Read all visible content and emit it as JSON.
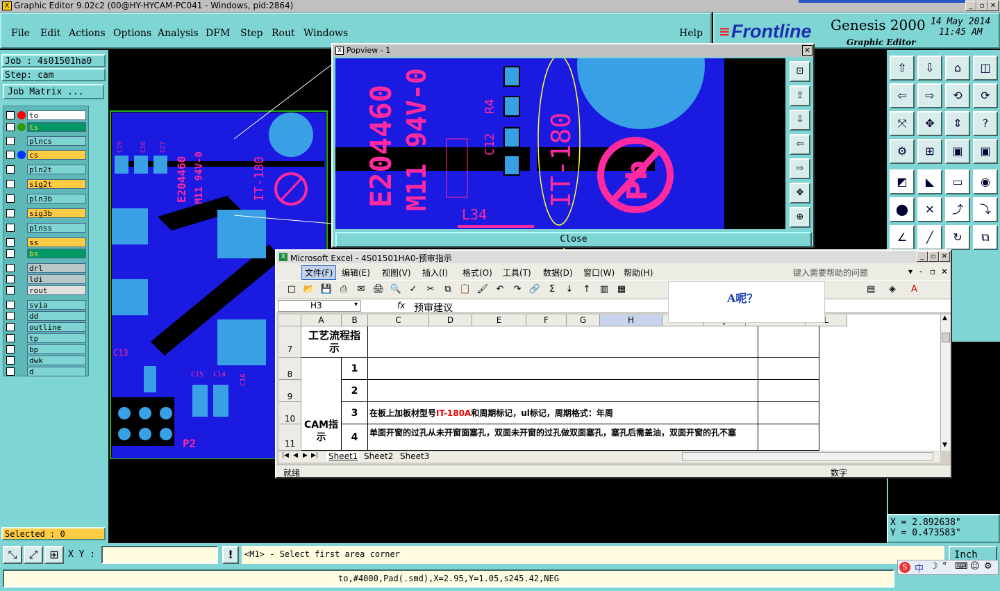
{
  "window": {
    "title": "Graphic Editor 9.02c2 (00@HY-HYCAM-PC041 - Windows, pid:2864)"
  },
  "menu": [
    "File",
    "Edit",
    "Actions",
    "Options",
    "Analysis",
    "DFM",
    "Step",
    "Rout",
    "Windows"
  ],
  "help": "Help",
  "brand": {
    "logo": "Frontline",
    "product": "Genesis 2000",
    "sub": "Graphic Editor",
    "date": "14 May 2014",
    "time": "11:45 AM"
  },
  "job": {
    "job": "Job : 4s01501ha0",
    "step": "Step: cam",
    "matrix": "Job Matrix ..."
  },
  "layers": [
    {
      "name": "to",
      "bg": "#ffffff",
      "dot": "#ff0000"
    },
    {
      "name": "ts",
      "bg": "#009966",
      "dot": "#339900"
    },
    {
      "name": "plncs",
      "bg": "#7fd4d4",
      "dot": ""
    },
    {
      "name": "cs",
      "bg": "#ffcc44",
      "dot": "#0033ff"
    },
    {
      "name": "pln2t",
      "bg": "#7fd4d4",
      "dot": ""
    },
    {
      "name": "sig2t",
      "bg": "#ffcc44",
      "dot": ""
    },
    {
      "name": "pln3b",
      "bg": "#7fd4d4",
      "dot": ""
    },
    {
      "name": "sig3b",
      "bg": "#ffcc44",
      "dot": ""
    },
    {
      "name": "plnss",
      "bg": "#7fd4d4",
      "dot": ""
    },
    {
      "name": "ss",
      "bg": "#ffcc44",
      "dot": ""
    },
    {
      "name": "bs",
      "bg": "#009966",
      "dot": ""
    },
    {
      "name": "drl",
      "bg": "#b8c8c8",
      "dot": ""
    },
    {
      "name": "ldi",
      "bg": "#b8c8c8",
      "dot": ""
    },
    {
      "name": "rout",
      "bg": "#e0e0e0",
      "dot": ""
    },
    {
      "name": "svia",
      "bg": "#7fd4d4",
      "dot": ""
    },
    {
      "name": "dd",
      "bg": "#7fd4d4",
      "dot": ""
    },
    {
      "name": "outline",
      "bg": "#7fd4d4",
      "dot": ""
    },
    {
      "name": "tp",
      "bg": "#7fd4d4",
      "dot": ""
    },
    {
      "name": "bp",
      "bg": "#7fd4d4",
      "dot": ""
    },
    {
      "name": "dwk",
      "bg": "#7fd4d4",
      "dot": ""
    },
    {
      "name": "d",
      "bg": "#7fd4d4",
      "dot": ""
    }
  ],
  "selected": "Selected : 0",
  "coords": {
    "x": "X = 2.892638\"",
    "y": "Y = 0.473583\""
  },
  "xy_label": "X Y :",
  "prompt": "<M1> - Select first area corner",
  "units": "Inch",
  "status_line": "to,#4000,Pad(.smd),X=2.95,Y=1.05,s245.42,NEG",
  "popview": {
    "title": "Popview - 1",
    "close": "Close"
  },
  "board_text": {
    "ul": "E204460",
    "mat": "M11 94V-0",
    "part": "IT-180",
    "ref_l34": "L34",
    "ref_r4": "R4",
    "ref_c12": "C12",
    "pb": "Pb",
    "p2": "P2",
    "c15": "C15",
    "c14": "C14",
    "c16": "C16",
    "c13": "C13",
    "c19": "C19",
    "c26": "C26",
    "c27": "C27"
  },
  "excel": {
    "title": "Microsoft Excel - 4S01501HA0-预审指示",
    "menu": [
      "文件(F)",
      "编辑(E)",
      "视图(V)",
      "插入(I)",
      "格式(O)",
      "工具(T)",
      "数据(D)",
      "窗口(W)",
      "帮助(H)"
    ],
    "help_box": "键入需要帮助的问题",
    "namebox": "H3",
    "formula": "预审建议",
    "columns": [
      "A",
      "B",
      "C",
      "D",
      "E",
      "F",
      "G",
      "H",
      "I",
      "J",
      "K",
      "L"
    ],
    "rows": [
      {
        "num": "7",
        "a": "工艺流程指示",
        "b": "",
        "c": ""
      },
      {
        "num": "8",
        "a": "",
        "b": "1",
        "c": ""
      },
      {
        "num": "9",
        "a": "",
        "b": "2",
        "c": ""
      },
      {
        "num": "10",
        "a": "",
        "b": "3",
        "c_pre": "在板上加板材型号",
        "c_red": "IT-180A",
        "c_post": "和周期标记，ul标记，周期格式：年周"
      },
      {
        "num": "11",
        "a": "CAM指示",
        "b": "4",
        "c": "单面开窗的过孔从未开窗面塞孔，双面未开窗的过孔做双面塞孔，塞孔后需盖油，双面开窗的孔不塞"
      }
    ],
    "sheets": [
      "Sheet1",
      "Sheet2",
      "Sheet3"
    ],
    "status_left": "就绪",
    "status_right": "数字",
    "question": "A呢？"
  },
  "ime": "中"
}
